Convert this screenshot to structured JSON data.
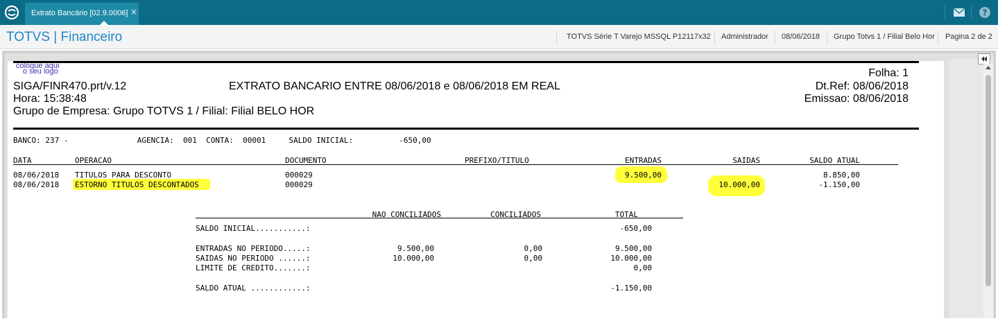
{
  "tab": {
    "title": "Extrato Bancário [02.9.0006]",
    "close": "×"
  },
  "colors": {
    "topbar": "#0c6b86",
    "tab": "#1f8aa6",
    "title": "#1f86c9",
    "highlight": "#ffff3a"
  },
  "icons": {
    "app_logo": "totvs-logo-icon",
    "mail": "mail-icon",
    "help": "help-icon",
    "collapse": "double-chevron-left-icon"
  },
  "header": {
    "title": "TOTVS | Financeiro",
    "environment": "TOTVS Série T Varejo MSSQL P12117x32",
    "user": "Administrador",
    "date": "08/06/2018",
    "company": "Grupo Totvs 1 / Filial Belo Hor",
    "page": "Pagina 2 de 2"
  },
  "report": {
    "logo_line1": "coloque aqui",
    "logo_line2": "o seu logo",
    "folha": "Folha:   1",
    "program": "SIGA/FINR470.prt/v.12",
    "title": "EXTRATO BANCARIO ENTRE  08/06/2018 e 08/06/2018  EM  REAL",
    "dtref": "Dt.Ref: 08/06/2018",
    "hora": "Hora: 15:38:48",
    "emissao": "Emissao: 08/06/2018",
    "grupo": "Grupo de Empresa: Grupo TOTVS 1 / Filial: Filial BELO HOR",
    "bank_line": "BANCO: 237 -               AGENCIA:  001  CONTA:  00001     SALDO INICIAL:          -650,00",
    "columns": {
      "data": "DATA",
      "operacao": "OPERACAO",
      "documento": "DOCUMENTO",
      "prefixo": "PREFIXO/TITULO",
      "entradas": "ENTRADAS",
      "saidas": "SAIDAS",
      "saldo": "SALDO ATUAL"
    },
    "rows": [
      {
        "data": "08/06/2018",
        "operacao": "TITULOS PARA DESCONTO",
        "documento": "000029",
        "entradas": "9.500,00",
        "saidas": "",
        "saldo": "8.850,00"
      },
      {
        "data": "08/06/2018",
        "operacao": "ESTORNO TITULOS DESCONTADOS",
        "documento": "000029",
        "entradas": "",
        "saidas": "10.000,00",
        "saldo": "-1.150,00"
      }
    ],
    "summary": {
      "headers": {
        "nao": "NAO CONCILIADOS",
        "conc": "CONCILIADOS",
        "total": "TOTAL"
      },
      "saldo_inicial": {
        "label": "SALDO INICIAL...........:",
        "total": "-650,00"
      },
      "entradas": {
        "label": "ENTRADAS NO PERIODO.....:",
        "nao": "9.500,00",
        "conc": "0,00",
        "total": "9.500,00"
      },
      "saidas": {
        "label": "SAIDAS NO PERIODO ......:",
        "nao": "10.000,00",
        "conc": "0,00",
        "total": "10.000,00"
      },
      "limite": {
        "label": "LIMITE DE CREDITO.......:",
        "total": "0,00"
      },
      "saldo_atual": {
        "label": "SALDO ATUAL ............:",
        "total": "-1.150,00"
      }
    }
  }
}
